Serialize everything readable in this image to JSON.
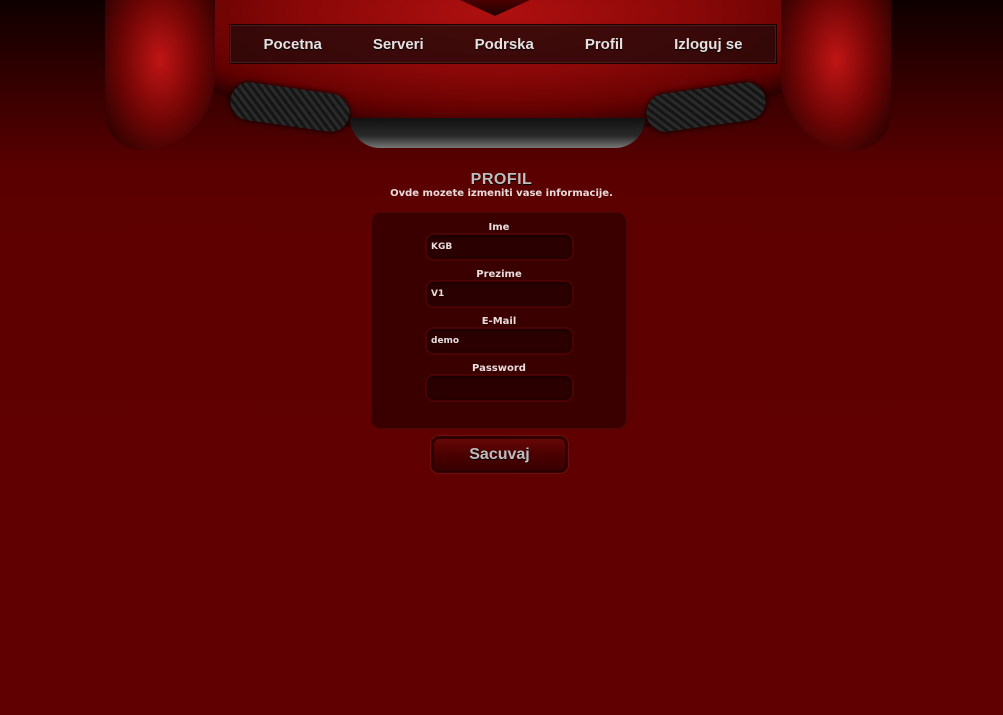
{
  "nav": {
    "items": [
      {
        "label": "Pocetna"
      },
      {
        "label": "Serveri"
      },
      {
        "label": "Podrska"
      },
      {
        "label": "Profil"
      },
      {
        "label": "Izloguj se"
      }
    ]
  },
  "page": {
    "title": "PROFIL",
    "subtitle": "Ovde mozete izmeniti vase informacije."
  },
  "form": {
    "fields": [
      {
        "label": "Ime",
        "value": "KGB"
      },
      {
        "label": "Prezime",
        "value": "V1"
      },
      {
        "label": "E-Mail",
        "value": "demo"
      },
      {
        "label": "Password",
        "value": ""
      }
    ],
    "save_label": "Sacuvaj"
  },
  "colors": {
    "background": "#600000",
    "panel": "#3a0000",
    "input": "#2a0000",
    "nav_bg": "#280a0a"
  }
}
